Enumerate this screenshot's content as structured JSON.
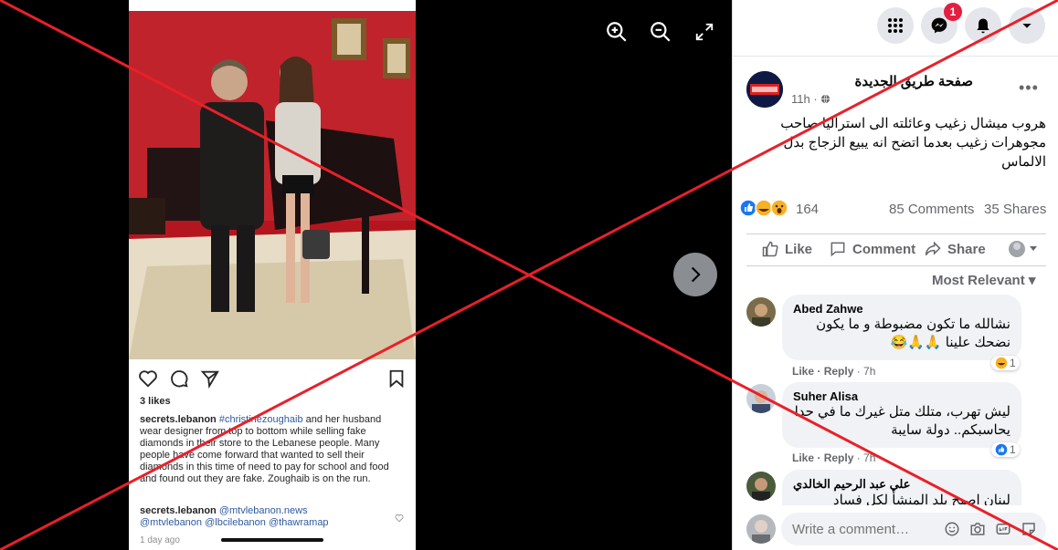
{
  "instagram": {
    "likes": "3 likes",
    "caption_user": "secrets.lebanon",
    "caption_tag": "#christinezoughaib",
    "caption_text": "and her husband wear designer from top to bottom while selling fake diamonds in their store to the Lebanese people. Many people have come forward that wanted to sell their diamonds in this time of need to pay for school and food and found out they are fake. Zoughaib is on the run.",
    "reply_user": "secrets.lebanon",
    "reply_tags_line1": "@mtvlebanon.news",
    "reply_tags_line2": "@mtvlebanon @lbcilebanon @thawramap",
    "time": "1 day ago"
  },
  "topbar": {
    "messenger_badge": "1"
  },
  "post": {
    "page_name": "صفحة طريق الجديدة",
    "time": "11h ·",
    "text": "هروب ميشال زغيب وعائلته الى استراليا صاحب مجوهرات زغيب بعدما اتضح انه يبيع الزجاج بدل الالماس",
    "reaction_count": "164",
    "comments": "85 Comments",
    "shares": "35 Shares",
    "actions": {
      "like": "Like",
      "comment": "Comment",
      "share": "Share"
    },
    "sort": "Most Relevant ▾"
  },
  "comments": [
    {
      "name": "Abed Zahwe",
      "text": "نشالله ما تكون مضبوطة و ما يكون نضحك علينا 🙏🙏😂",
      "like": "Like",
      "reply": "Reply",
      "time": "· 7h",
      "reactions": "1"
    },
    {
      "name": "Suher Alisa",
      "text": "ليش تهرب، متلك متل غيرك ما في حدا يحاسبكم.. دولة سايبة",
      "like": "Like",
      "reply": "Reply",
      "time": "· 7h",
      "reactions": "1"
    },
    {
      "name": "علي عبد الرحيم الخالدي",
      "text": "لبنان اصبح بلد المنشأ لكل فساد"
    }
  ],
  "write_comment": {
    "placeholder": "Write a comment…"
  }
}
